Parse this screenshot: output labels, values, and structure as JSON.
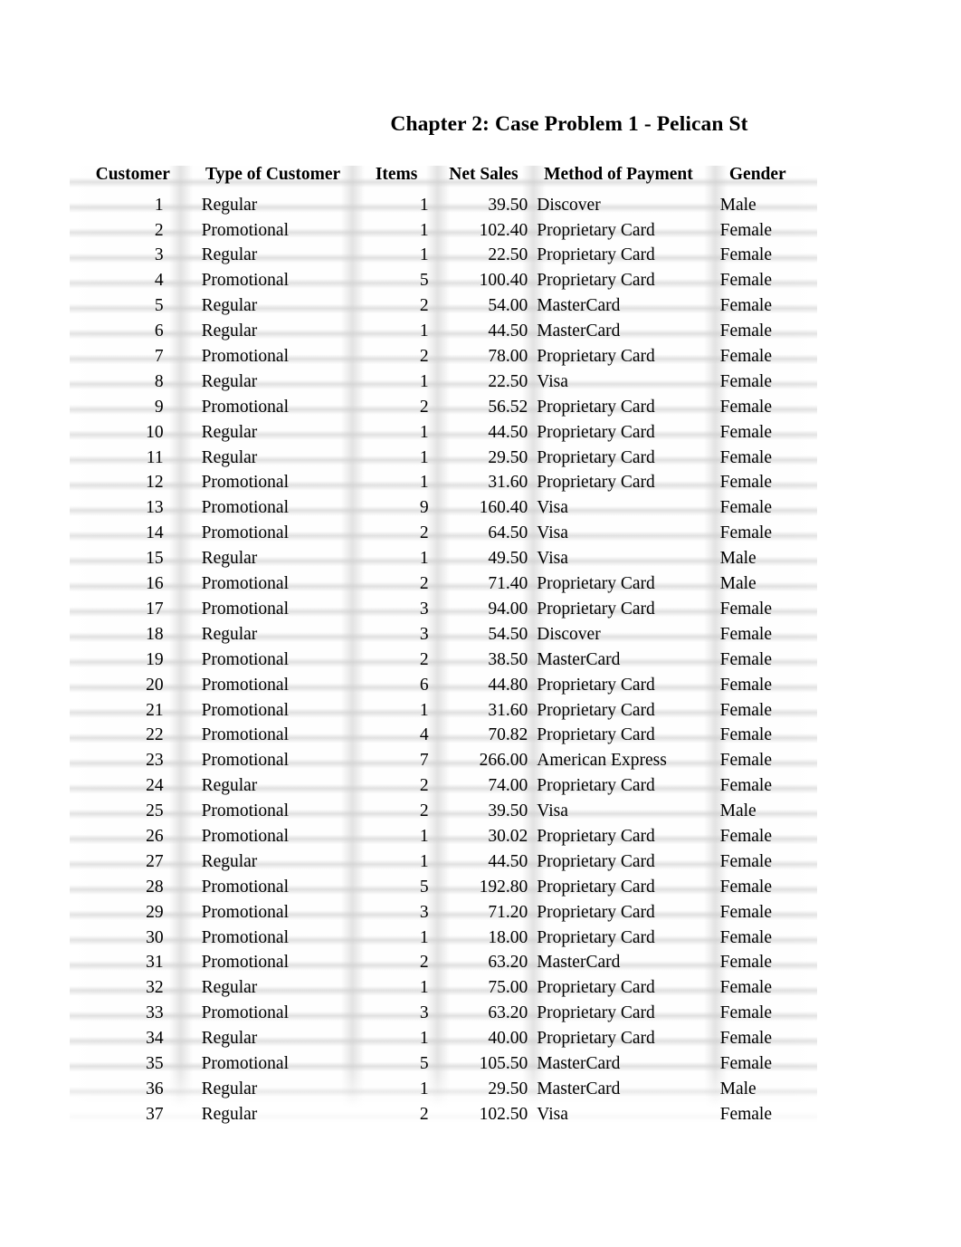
{
  "document": {
    "title": "Chapter 2: Case Problem 1 - Pelican St"
  },
  "table": {
    "columns": [
      {
        "key": "customer",
        "label": "Customer",
        "align": "right"
      },
      {
        "key": "type",
        "label": "Type of Customer",
        "align": "left"
      },
      {
        "key": "items",
        "label": "Items",
        "align": "right"
      },
      {
        "key": "sales",
        "label": "Net Sales",
        "align": "right"
      },
      {
        "key": "method",
        "label": "Method of Payment",
        "align": "left"
      },
      {
        "key": "gender",
        "label": "Gender",
        "align": "left"
      }
    ],
    "row_count": 37,
    "rows": [
      {
        "customer": "1",
        "type": "Regular",
        "items": "1",
        "sales": "39.50",
        "method": "Discover",
        "gender": "Male"
      },
      {
        "customer": "2",
        "type": "Promotional",
        "items": "1",
        "sales": "102.40",
        "method": "Proprietary Card",
        "gender": "Female"
      },
      {
        "customer": "3",
        "type": "Regular",
        "items": "1",
        "sales": "22.50",
        "method": "Proprietary Card",
        "gender": "Female"
      },
      {
        "customer": "4",
        "type": "Promotional",
        "items": "5",
        "sales": "100.40",
        "method": "Proprietary Card",
        "gender": "Female"
      },
      {
        "customer": "5",
        "type": "Regular",
        "items": "2",
        "sales": "54.00",
        "method": "MasterCard",
        "gender": "Female"
      },
      {
        "customer": "6",
        "type": "Regular",
        "items": "1",
        "sales": "44.50",
        "method": "MasterCard",
        "gender": "Female"
      },
      {
        "customer": "7",
        "type": "Promotional",
        "items": "2",
        "sales": "78.00",
        "method": "Proprietary Card",
        "gender": "Female"
      },
      {
        "customer": "8",
        "type": "Regular",
        "items": "1",
        "sales": "22.50",
        "method": "Visa",
        "gender": "Female"
      },
      {
        "customer": "9",
        "type": "Promotional",
        "items": "2",
        "sales": "56.52",
        "method": "Proprietary Card",
        "gender": "Female"
      },
      {
        "customer": "10",
        "type": "Regular",
        "items": "1",
        "sales": "44.50",
        "method": "Proprietary Card",
        "gender": "Female"
      },
      {
        "customer": "11",
        "type": "Regular",
        "items": "1",
        "sales": "29.50",
        "method": "Proprietary Card",
        "gender": "Female"
      },
      {
        "customer": "12",
        "type": "Promotional",
        "items": "1",
        "sales": "31.60",
        "method": "Proprietary Card",
        "gender": "Female"
      },
      {
        "customer": "13",
        "type": "Promotional",
        "items": "9",
        "sales": "160.40",
        "method": "Visa",
        "gender": "Female"
      },
      {
        "customer": "14",
        "type": "Promotional",
        "items": "2",
        "sales": "64.50",
        "method": "Visa",
        "gender": "Female"
      },
      {
        "customer": "15",
        "type": "Regular",
        "items": "1",
        "sales": "49.50",
        "method": "Visa",
        "gender": "Male"
      },
      {
        "customer": "16",
        "type": "Promotional",
        "items": "2",
        "sales": "71.40",
        "method": "Proprietary Card",
        "gender": "Male"
      },
      {
        "customer": "17",
        "type": "Promotional",
        "items": "3",
        "sales": "94.00",
        "method": "Proprietary Card",
        "gender": "Female"
      },
      {
        "customer": "18",
        "type": "Regular",
        "items": "3",
        "sales": "54.50",
        "method": "Discover",
        "gender": "Female"
      },
      {
        "customer": "19",
        "type": "Promotional",
        "items": "2",
        "sales": "38.50",
        "method": "MasterCard",
        "gender": "Female"
      },
      {
        "customer": "20",
        "type": "Promotional",
        "items": "6",
        "sales": "44.80",
        "method": "Proprietary Card",
        "gender": "Female"
      },
      {
        "customer": "21",
        "type": "Promotional",
        "items": "1",
        "sales": "31.60",
        "method": "Proprietary Card",
        "gender": "Female"
      },
      {
        "customer": "22",
        "type": "Promotional",
        "items": "4",
        "sales": "70.82",
        "method": "Proprietary Card",
        "gender": "Female"
      },
      {
        "customer": "23",
        "type": "Promotional",
        "items": "7",
        "sales": "266.00",
        "method": "American Express",
        "gender": "Female"
      },
      {
        "customer": "24",
        "type": "Regular",
        "items": "2",
        "sales": "74.00",
        "method": "Proprietary Card",
        "gender": "Female"
      },
      {
        "customer": "25",
        "type": "Promotional",
        "items": "2",
        "sales": "39.50",
        "method": "Visa",
        "gender": "Male"
      },
      {
        "customer": "26",
        "type": "Promotional",
        "items": "1",
        "sales": "30.02",
        "method": "Proprietary Card",
        "gender": "Female"
      },
      {
        "customer": "27",
        "type": "Regular",
        "items": "1",
        "sales": "44.50",
        "method": "Proprietary Card",
        "gender": "Female"
      },
      {
        "customer": "28",
        "type": "Promotional",
        "items": "5",
        "sales": "192.80",
        "method": "Proprietary Card",
        "gender": "Female"
      },
      {
        "customer": "29",
        "type": "Promotional",
        "items": "3",
        "sales": "71.20",
        "method": "Proprietary Card",
        "gender": "Female"
      },
      {
        "customer": "30",
        "type": "Promotional",
        "items": "1",
        "sales": "18.00",
        "method": "Proprietary Card",
        "gender": "Female"
      },
      {
        "customer": "31",
        "type": "Promotional",
        "items": "2",
        "sales": "63.20",
        "method": "MasterCard",
        "gender": "Female"
      },
      {
        "customer": "32",
        "type": "Regular",
        "items": "1",
        "sales": "75.00",
        "method": "Proprietary Card",
        "gender": "Female"
      },
      {
        "customer": "33",
        "type": "Promotional",
        "items": "3",
        "sales": "63.20",
        "method": "Proprietary Card",
        "gender": "Female"
      },
      {
        "customer": "34",
        "type": "Regular",
        "items": "1",
        "sales": "40.00",
        "method": "Proprietary Card",
        "gender": "Female"
      },
      {
        "customer": "35",
        "type": "Promotional",
        "items": "5",
        "sales": "105.50",
        "method": "MasterCard",
        "gender": "Female"
      },
      {
        "customer": "36",
        "type": "Regular",
        "items": "1",
        "sales": "29.50",
        "method": "MasterCard",
        "gender": "Male"
      },
      {
        "customer": "37",
        "type": "Regular",
        "items": "2",
        "sales": "102.50",
        "method": "Visa",
        "gender": "Female"
      }
    ]
  }
}
